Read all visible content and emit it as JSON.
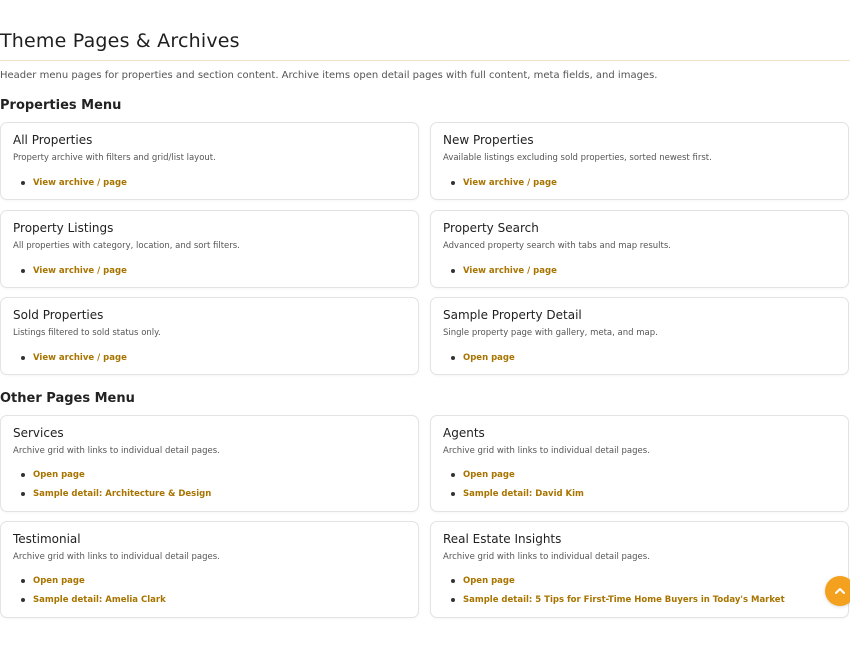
{
  "header": {
    "title": "Theme Pages & Archives",
    "intro": "Header menu pages for properties and section content. Archive items open detail pages with full content, meta fields, and images."
  },
  "sections": {
    "properties": {
      "heading": "Properties Menu",
      "cards": [
        {
          "title": "All Properties",
          "desc": "Property archive with filters and grid/list layout.",
          "links": [
            "View archive / page"
          ]
        },
        {
          "title": "New Properties",
          "desc": "Available listings excluding sold properties, sorted newest first.",
          "links": [
            "View archive / page"
          ]
        },
        {
          "title": "Property Listings",
          "desc": "All properties with category, location, and sort filters.",
          "links": [
            "View archive / page"
          ]
        },
        {
          "title": "Property Search",
          "desc": "Advanced property search with tabs and map results.",
          "links": [
            "View archive / page"
          ]
        },
        {
          "title": "Sold Properties",
          "desc": "Listings filtered to sold status only.",
          "links": [
            "View archive / page"
          ]
        },
        {
          "title": "Sample Property Detail",
          "desc": "Single property page with gallery, meta, and map.",
          "links": [
            "Open page"
          ]
        }
      ]
    },
    "other": {
      "heading": "Other Pages Menu",
      "cards": [
        {
          "title": "Services",
          "desc": "Archive grid with links to individual detail pages.",
          "links": [
            "Open page",
            "Sample detail: Architecture & Design"
          ]
        },
        {
          "title": "Agents",
          "desc": "Archive grid with links to individual detail pages.",
          "links": [
            "Open page",
            "Sample detail: David Kim"
          ]
        },
        {
          "title": "Testimonial",
          "desc": "Archive grid with links to individual detail pages.",
          "links": [
            "Open page",
            "Sample detail: Amelia Clark"
          ]
        },
        {
          "title": "Real Estate Insights",
          "desc": "Archive grid with links to individual detail pages.",
          "links": [
            "Open page",
            "Sample detail: 5 Tips for First-Time Home Buyers in Today's Market"
          ]
        }
      ]
    }
  },
  "colors": {
    "accent": "#a87400",
    "fab": "#f4a11f"
  },
  "fab": {
    "icon": "chevron-up-icon"
  }
}
